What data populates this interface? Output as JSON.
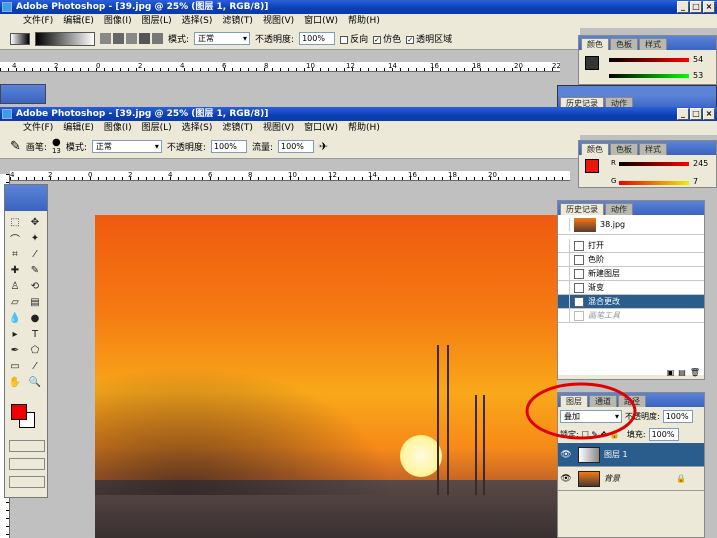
{
  "back_window": {
    "title": "Adobe Photoshop - [39.jpg @ 25% (图层 1, RGB/8)]",
    "menu": [
      "文件(F)",
      "编辑(E)",
      "图像(I)",
      "图层(L)",
      "选择(S)",
      "滤镜(T)",
      "视图(V)",
      "窗口(W)",
      "帮助(H)"
    ],
    "mode_label": "模式:",
    "mode_value": "正常",
    "opacity_label": "不透明度:",
    "opacity_value": "100%",
    "reverse_label": "反向",
    "dither_label": "仿色",
    "transparency_label": "透明区域",
    "ruler_ticks": [
      "4",
      "2",
      "0",
      "2",
      "4",
      "6",
      "8",
      "10",
      "12",
      "14",
      "16",
      "18",
      "20",
      "22"
    ],
    "color_tabs": [
      "颜色",
      "色板",
      "样式"
    ],
    "r_value": "54",
    "g_value": "53",
    "history_tab": "历史记录",
    "actions_tab": "动作"
  },
  "front_window": {
    "title": "Adobe Photoshop - [39.jpg @ 25% (图层 1, RGB/8)]",
    "menu": [
      "文件(F)",
      "编辑(E)",
      "图像(I)",
      "图层(L)",
      "选择(S)",
      "滤镜(T)",
      "视图(V)",
      "窗口(W)",
      "帮助(H)"
    ],
    "brush_label": "画笔:",
    "brush_size": "13",
    "mode_label": "模式:",
    "mode_value": "正常",
    "opacity_label": "不透明度:",
    "opacity_value": "100%",
    "flow_label": "流量:",
    "flow_value": "100%",
    "ruler_ticks": [
      "4",
      "2",
      "0",
      "2",
      "4",
      "6",
      "8",
      "10",
      "12",
      "14",
      "16",
      "18",
      "20"
    ]
  },
  "color_panel": {
    "tabs": [
      "颜色",
      "色板",
      "样式"
    ],
    "r_label": "R",
    "g_label": "G",
    "r_value": "245",
    "g_value": "7",
    "fg_color": "#e8160c"
  },
  "history_panel": {
    "tabs": [
      "历史记录",
      "动作"
    ],
    "snapshot": "38.jpg",
    "items": [
      "打开",
      "色阶",
      "新建图层",
      "渐变",
      "混合更改",
      "画笔工具"
    ],
    "selected_index": 4,
    "dimmed_index": 5
  },
  "layers_panel": {
    "tabs": [
      "图层",
      "通道",
      "路径"
    ],
    "blend_mode": "叠加",
    "opacity_label": "不透明度:",
    "opacity_value": "100%",
    "lock_label": "锁定:",
    "fill_label": "填充:",
    "fill_value": "100%",
    "layers": [
      {
        "name": "图层 1",
        "selected": true
      },
      {
        "name": "背景",
        "selected": false,
        "italic": true
      }
    ]
  },
  "toolbox": {
    "foreground": "#f00000",
    "background": "#ffffff"
  },
  "annotation_color": "#e00000"
}
